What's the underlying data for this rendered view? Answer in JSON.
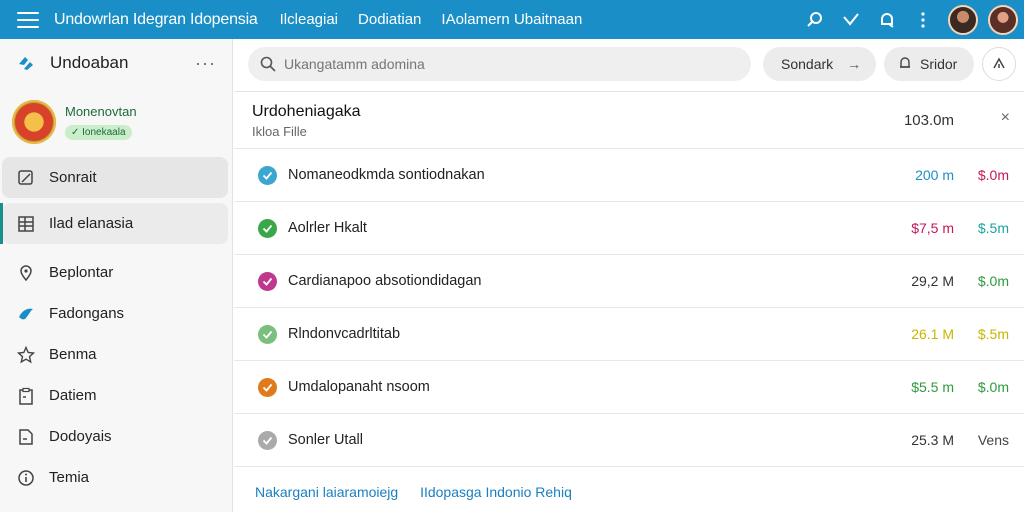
{
  "topbar": {
    "app_title": "Undowrlan Idegran Idopensia",
    "nav": [
      "Ilcleagiai",
      "Dodiatian",
      "IAolamern Ubaitnaan"
    ],
    "icons": [
      "search-icon",
      "check-icon",
      "bell-icon",
      "more-vert-icon"
    ]
  },
  "sidebar": {
    "brand": "Undoaban",
    "more": "···",
    "profile": {
      "name": "Monenovtan",
      "badge": "✓ Ionekaala"
    },
    "items": [
      {
        "label": "Sonrait",
        "icon": "edit-icon"
      },
      {
        "label": "Ilad elanasia",
        "icon": "grid-icon"
      },
      {
        "label": "Beplontar",
        "icon": "pin-icon"
      },
      {
        "label": "Fadongans",
        "icon": "bird-icon"
      },
      {
        "label": "Benma",
        "icon": "star-icon"
      },
      {
        "label": "Datiem",
        "icon": "clipboard-icon"
      },
      {
        "label": "Dodoyais",
        "icon": "file-icon"
      },
      {
        "label": "Temia",
        "icon": "info-icon"
      }
    ]
  },
  "search": {
    "placeholder": "Ukangatamm adomina"
  },
  "toolbar": {
    "sort_label": "Sondark",
    "sort_arrow": "→",
    "filter_label": "Sridor"
  },
  "panel": {
    "title": "Urdoheniagaka",
    "subtitle": "Ikloa Fille",
    "size": "103.0m",
    "close": "×"
  },
  "rows": [
    {
      "name": "Nomaneodkmda sontiodnakan",
      "v1": "200 m",
      "v2": "$.0m",
      "check_color": "#3ba6cf",
      "v1_color": "#1f8fc2",
      "v2_color": "#c2185b"
    },
    {
      "name": "Aolrler Hkalt",
      "v1": "$7,5 m",
      "v2": "$.5m",
      "check_color": "#3aa84a",
      "v1_color": "#c2185b",
      "v2_color": "#1aa3a3"
    },
    {
      "name": "Cardianapoo absotiondidagan",
      "v1": "29,2 M",
      "v2": "$.0m",
      "check_color": "#c0378e",
      "v1_color": "#333333",
      "v2_color": "#2e9a3e"
    },
    {
      "name": "Rlndonvcadrltitab",
      "v1": "26.1 M",
      "v2": "$.5m",
      "check_color": "#7bbf7e",
      "v1_color": "#c9b400",
      "v2_color": "#c9b400"
    },
    {
      "name": "Umdalopanaht nsoom",
      "v1": "$5.5 m",
      "v2": "$.0m",
      "check_color": "#e07b1c",
      "v1_color": "#2e9a3e",
      "v2_color": "#2e9a3e"
    },
    {
      "name": "Sonler Utall",
      "v1": "25.3 M",
      "v2": "Vens",
      "check_color": "#aaaaaa",
      "v1_color": "#333333",
      "v2_color": "#444444"
    }
  ],
  "footer_links": [
    "Nakargani laiaramoiejg",
    "IIdopasga Indonio Rehiq"
  ]
}
